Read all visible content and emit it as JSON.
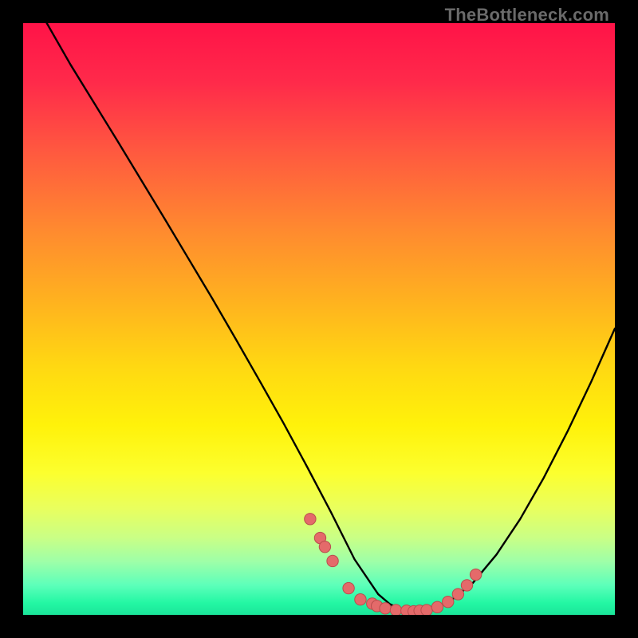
{
  "watermark": "TheBottleneck.com",
  "colors": {
    "frame": "#000000",
    "curve_stroke": "#000000",
    "marker_fill": "#e46a6a",
    "marker_stroke": "#b94d4d"
  },
  "chart_data": {
    "type": "line",
    "title": "",
    "xlabel": "",
    "ylabel": "",
    "xlim": [
      0,
      100
    ],
    "ylim": [
      0,
      100
    ],
    "series": [
      {
        "name": "curve",
        "x": [
          4,
          8,
          12,
          16,
          20,
          24,
          28,
          32,
          36,
          40,
          44,
          48,
          52,
          56,
          60,
          62,
          64,
          66,
          68,
          72,
          76,
          80,
          84,
          88,
          92,
          96,
          100
        ],
        "y": [
          100,
          93,
          86.5,
          80,
          73.4,
          66.8,
          60.1,
          53.4,
          46.5,
          39.5,
          32.4,
          25,
          17.4,
          9.4,
          3.5,
          1.8,
          0.9,
          0.6,
          0.8,
          2.2,
          5.4,
          10.2,
          16.2,
          23.2,
          31.0,
          39.4,
          48.4
        ]
      },
      {
        "name": "markers",
        "x": [
          48.5,
          50.2,
          51.0,
          52.3,
          55.0,
          57.0,
          59.0,
          59.8,
          61.2,
          63.0,
          64.8,
          66.0,
          67.0,
          68.2,
          70.0,
          71.8,
          73.5,
          75.0,
          76.5
        ],
        "y": [
          16.2,
          13.0,
          11.5,
          9.1,
          4.5,
          2.6,
          1.9,
          1.5,
          1.1,
          0.8,
          0.7,
          0.6,
          0.7,
          0.8,
          1.3,
          2.2,
          3.5,
          5.0,
          6.8
        ]
      }
    ]
  }
}
